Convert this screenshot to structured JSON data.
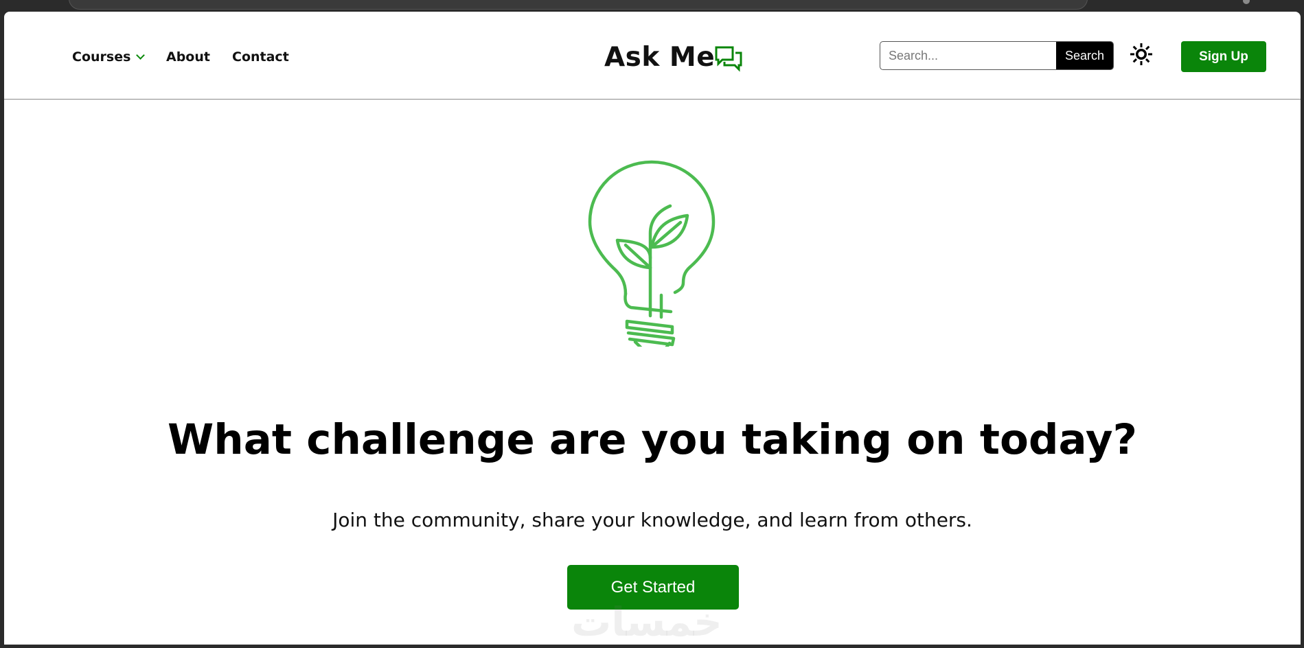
{
  "nav": {
    "courses": "Courses",
    "about": "About",
    "contact": "Contact"
  },
  "logo": {
    "text": "Ask Me",
    "icon": "chat-bubbles-icon"
  },
  "search": {
    "placeholder": "Search...",
    "value": "",
    "button_label": "Search"
  },
  "theme_toggle": {
    "icon": "sun-icon"
  },
  "signup": {
    "label": "Sign Up"
  },
  "hero": {
    "icon": "lightbulb-plant-icon",
    "title": "What challenge are you taking on today?",
    "subtitle": "Join the community, share your knowledge, and learn from others.",
    "cta_label": "Get Started"
  },
  "watermark": {
    "text": "خمسات"
  },
  "colors": {
    "brand_green": "#0a850a",
    "icon_green": "#4cbb50",
    "search_button_bg": "#000000"
  }
}
